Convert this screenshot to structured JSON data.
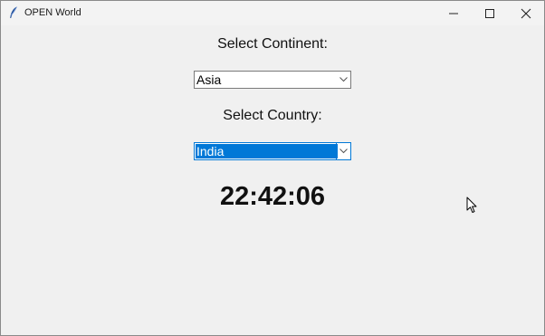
{
  "window": {
    "title": "OPEN World",
    "icon": "feather-icon",
    "controls": [
      "minimize-icon",
      "maximize-icon",
      "close-icon"
    ]
  },
  "form": {
    "continent_label": "Select Continent:",
    "continent_value": "Asia",
    "country_label": "Select Country:",
    "country_value": "India"
  },
  "clock": {
    "time": "22:42:06"
  },
  "colors": {
    "selection": "#0078d7",
    "window_bg": "#f0f0f0"
  }
}
